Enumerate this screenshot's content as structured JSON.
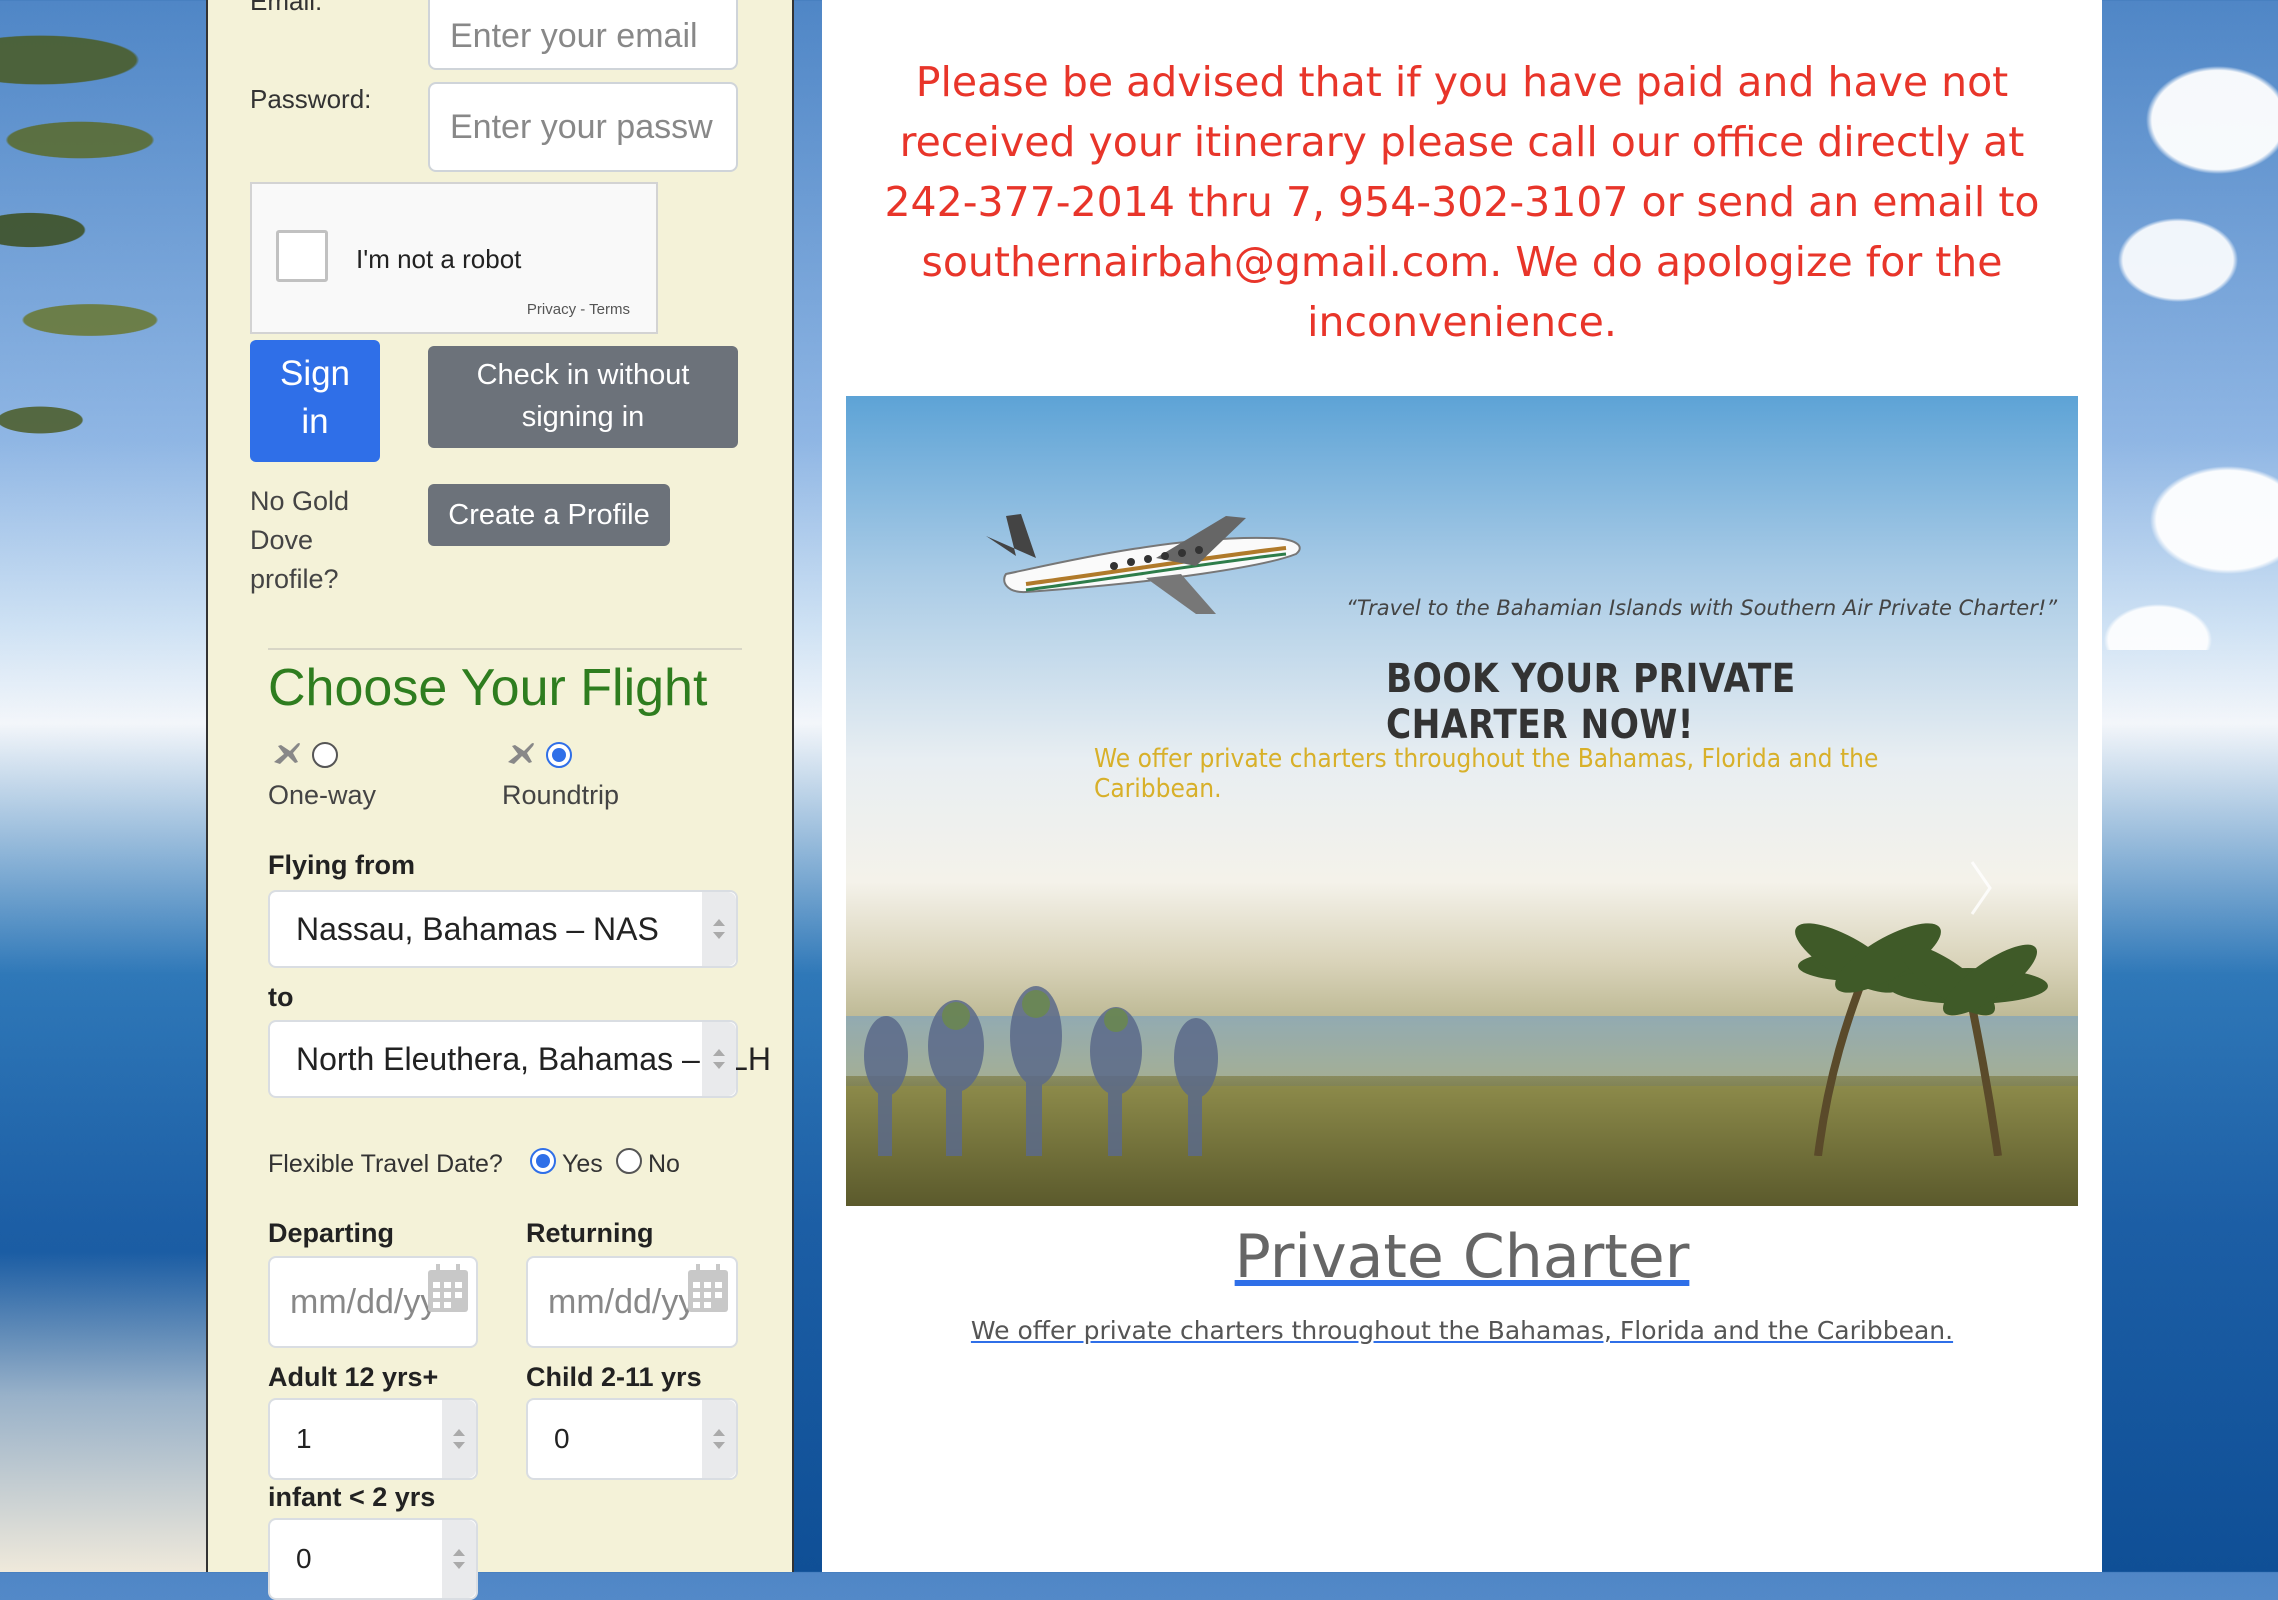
{
  "colors": {
    "primary_button": "#2f6fe8",
    "secondary_button": "#6c727a",
    "notice_text": "#e8352a",
    "choose_title": "#2e7d1f",
    "panel_background": "#f4f2d8",
    "offer_text": "#d8b02a"
  },
  "login": {
    "email_label": "Email:",
    "email_placeholder": "Enter your email",
    "password_label": "Password:",
    "password_placeholder": "Enter your passw",
    "captcha_label": "I'm not a robot",
    "captcha_links": "Privacy - Terms",
    "sign_in_line1": "Sign",
    "sign_in_line2": "in",
    "checkin_line1": "Check in without",
    "checkin_line2": "signing in",
    "no_profile_line1": "No Gold",
    "no_profile_line2": "Dove",
    "no_profile_line3": "profile?",
    "create_profile": "Create a Profile"
  },
  "flight": {
    "title": "Choose Your Flight",
    "trip_types": [
      {
        "label": "One-way",
        "icon": "plane-icon",
        "selected": false
      },
      {
        "label": "Roundtrip",
        "icon": "plane-icon",
        "selected": true
      }
    ],
    "flying_from_label": "Flying from",
    "flying_from_value": "Nassau, Bahamas – NAS",
    "to_label": "to",
    "to_value": "North Eleuthera, Bahamas – ELH",
    "flexible_label": "Flexible Travel Date?",
    "flexible_yes": "Yes",
    "flexible_no": "No",
    "flexible_selected": "Yes",
    "departing_label": "Departing",
    "departing_placeholder": "mm/dd/yy",
    "returning_label": "Returning",
    "returning_placeholder": "mm/dd/yy",
    "adult_label": "Adult 12 yrs+",
    "adult_value": "1",
    "child_label": "Child 2-11 yrs",
    "child_value": "0",
    "infant_label": "infant < 2 yrs",
    "infant_value": "0"
  },
  "main": {
    "notice": "Please be advised that if you have paid and have not received your itinerary please call our office directly at 242-377-2014 thru 7, 954-302-3107 or send an email to southernairbah@gmail.com. We do apologize for the inconvenience.",
    "slide_quote": "“Travel to the Bahamian Islands with Southern Air Private Charter!”",
    "slide_headline": "BOOK YOUR PRIVATE CHARTER NOW!",
    "slide_offer": "We offer private charters throughout the Bahamas, Florida and the Caribbean.",
    "charter_title": "Private Charter",
    "charter_subtitle": "We offer private charters throughout the Bahamas, Florida and the Caribbean."
  }
}
